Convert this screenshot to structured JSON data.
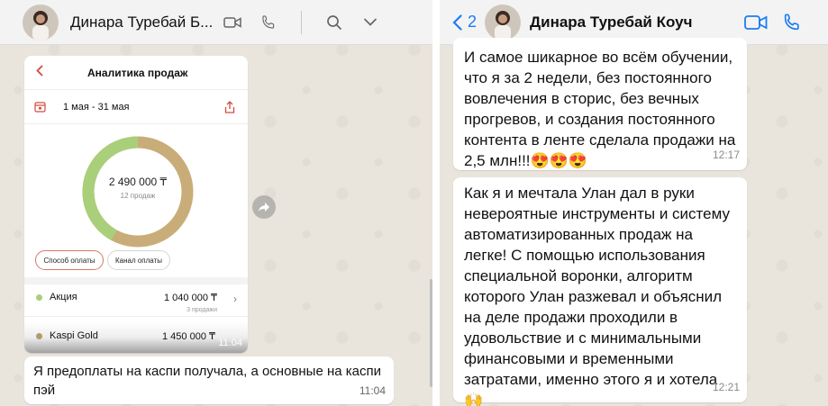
{
  "left_chat": {
    "contact_name": "Динара Туребай Б...",
    "header_icons": [
      "video-camera-icon",
      "phone-icon",
      "search-icon",
      "chevron-down-icon"
    ],
    "analytics_image": {
      "title": "Аналитика продаж",
      "date_range": "1 мая - 31 мая",
      "total": "2 490 000 ₸",
      "total_sub": "12 продаж",
      "chip_payment": "Способ оплаты",
      "chip_channel": "Канал оплаты",
      "rows": [
        {
          "label": "Акция",
          "amount": "1 040 000 ₸",
          "count": "3 продажи",
          "color": "#a9cf7b"
        },
        {
          "label": "Kaspi Gold",
          "amount": "1 450 000 ₸",
          "color": "#b39a6a"
        }
      ],
      "time": "11:04"
    },
    "message": {
      "text": "Я предоплаты на каспи получала, а основные на каспи пэй",
      "time": "11:04"
    }
  },
  "right_chat": {
    "back_count": "2",
    "contact_name": "Динара Туребай Коуч",
    "header_icons": [
      "video-camera-icon",
      "phone-icon"
    ],
    "messages": [
      {
        "text": "И самое шикарное во всём обучении, что я за 2 недели, без постоянного вовлечения в сторис, без вечных прогревов, и создания постоянного контента в ленте  сделала продажи на 2,5 млн!!!😍😍😍",
        "time": "12:17"
      },
      {
        "text": "Как я и мечтала Улан дал в руки невероятные инструменты и систему автоматизированных продаж на легке! С помощью использования специальной воронки, алгоритм которого Улан разжевал и объяснил на деле продажи проходили в удовольствие и с минимальными финансовыми и временными затратами, именно этого я и хотела 🙌",
        "time": "12:21"
      }
    ]
  },
  "colors": {
    "ios_blue": "#1a7cf5",
    "donut_green": "#a9cf7b",
    "donut_gold": "#c9ad78",
    "accent_red": "#d24b3f"
  }
}
